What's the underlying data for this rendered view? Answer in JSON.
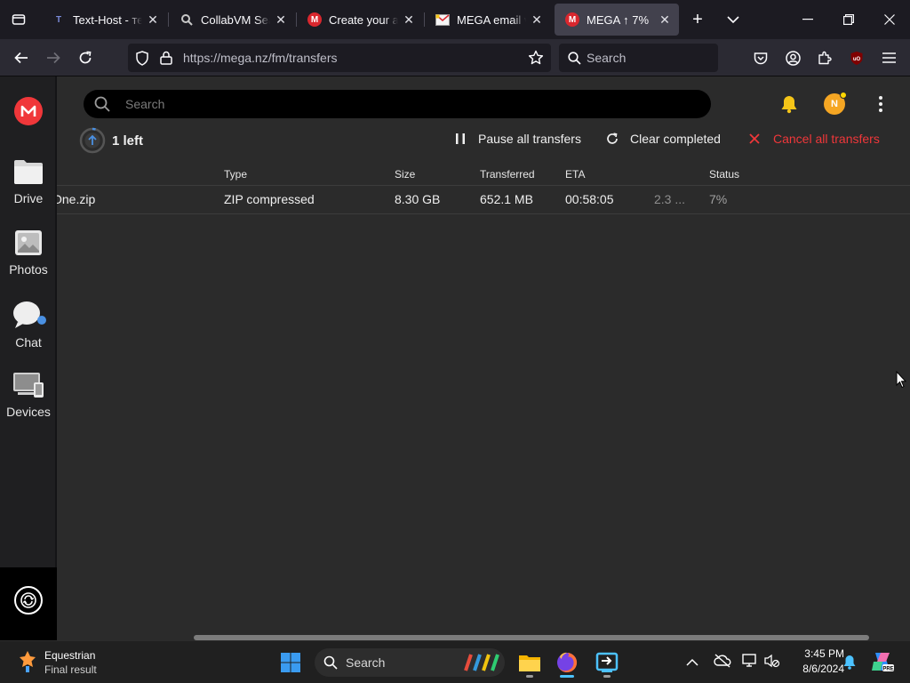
{
  "tabs": [
    {
      "title": "Text-Host - текст",
      "icon": "text-host-icon"
    },
    {
      "title": "CollabVM SearXNG",
      "icon": "searxng-icon"
    },
    {
      "title": "Create your account",
      "icon": "mega-icon"
    },
    {
      "title": "MEGA email verification",
      "icon": "mail-icon"
    },
    {
      "title": "MEGA ↑ 7%",
      "icon": "mega-icon",
      "active": true
    }
  ],
  "url": "https://mega.nz/fm/transfers",
  "browser_search_placeholder": "Search",
  "sidebar": {
    "items": [
      {
        "label": "Drive"
      },
      {
        "label": "Photos"
      },
      {
        "label": "Chat"
      },
      {
        "label": "Devices"
      }
    ]
  },
  "mega": {
    "search_placeholder": "Search",
    "avatar_initial": "N",
    "transfers_left": "1 left",
    "pause_label": "Pause all transfers",
    "clear_label": "Clear completed",
    "cancel_label": "Cancel all transfers"
  },
  "table": {
    "headers": {
      "type": "Type",
      "size": "Size",
      "transferred": "Transferred",
      "eta": "ETA",
      "status": "Status"
    },
    "rows": [
      {
        "name": "One.zip",
        "type": "ZIP compressed",
        "size": "8.30 GB",
        "transferred": "652.1 MB",
        "eta": "00:58:05",
        "speed": "2.3 ...",
        "status": "7%"
      }
    ]
  },
  "taskbar": {
    "weather_title": "Equestrian",
    "weather_sub": "Final result",
    "search_placeholder": "Search",
    "time": "3:45 PM",
    "date": "8/6/2024"
  },
  "colors": {
    "mega_red": "#f0373a",
    "cancel_red": "#f0373a",
    "avatar_yellow": "#f5a623",
    "accent_blue": "#4a90e2"
  }
}
